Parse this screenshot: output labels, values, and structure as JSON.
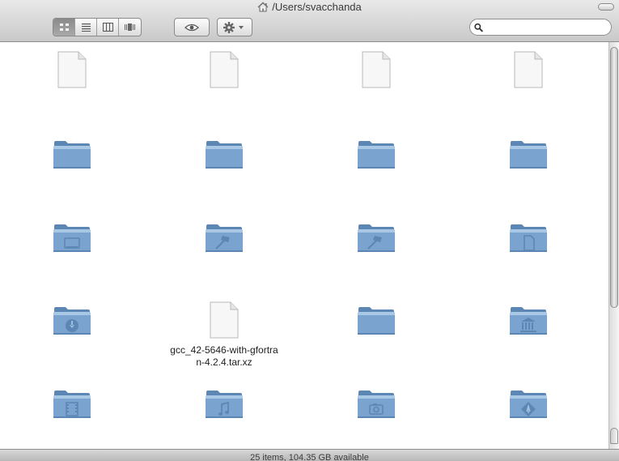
{
  "window": {
    "title": "/Users/svacchanda"
  },
  "toolbar": {
    "view_buttons": [
      "icon-view",
      "list-view",
      "column-view",
      "coverflow-view"
    ],
    "active_view": "icon-view",
    "search_placeholder": ""
  },
  "colors": {
    "folder": "#7aa4cf",
    "folder_dark": "#5c87b4",
    "accent": "#8a8a8a"
  },
  "items": [
    {
      "type": "document",
      "label": ""
    },
    {
      "type": "document",
      "label": ""
    },
    {
      "type": "document",
      "label": ""
    },
    {
      "type": "document",
      "label": ""
    },
    {
      "type": "folder",
      "label": ""
    },
    {
      "type": "folder",
      "label": ""
    },
    {
      "type": "folder",
      "label": ""
    },
    {
      "type": "folder",
      "label": ""
    },
    {
      "type": "folder-desktop",
      "label": ""
    },
    {
      "type": "folder-developer",
      "label": ""
    },
    {
      "type": "folder-developer",
      "label": ""
    },
    {
      "type": "folder-documents",
      "label": ""
    },
    {
      "type": "folder-downloads",
      "label": ""
    },
    {
      "type": "document",
      "label": "gcc_42-5646-with-gfortran-4.2.4.tar.xz"
    },
    {
      "type": "folder",
      "label": ""
    },
    {
      "type": "folder-library",
      "label": ""
    },
    {
      "type": "folder-movies",
      "label": ""
    },
    {
      "type": "folder-music",
      "label": ""
    },
    {
      "type": "folder-pictures",
      "label": ""
    },
    {
      "type": "folder-public",
      "label": ""
    }
  ],
  "status": {
    "text": "25 items, 104.35 GB available"
  }
}
